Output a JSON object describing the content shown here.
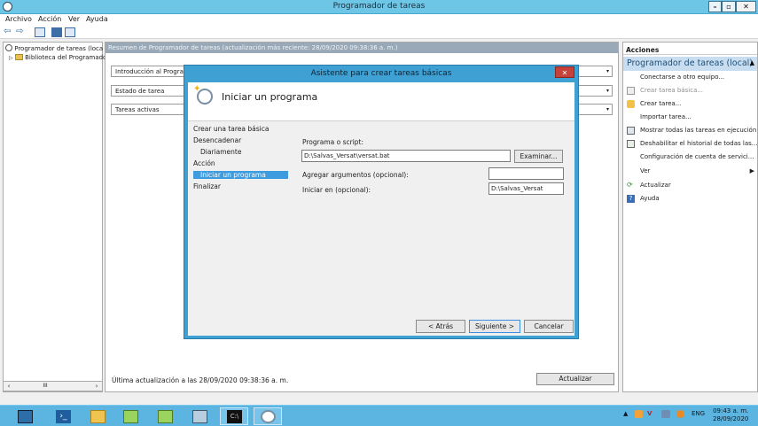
{
  "window": {
    "title": "Programador de tareas"
  },
  "menu": [
    "Archivo",
    "Acción",
    "Ver",
    "Ayuda"
  ],
  "tree": {
    "root": "Programador de tareas (local)",
    "child": "Biblioteca del Programador de tareas"
  },
  "center": {
    "summary_header": "Resumen de Programador de tareas (actualización más reciente: 28/09/2020 09:38:36 a. m.)",
    "sections": [
      "Introducción al Programador de tareas",
      "Estado de tarea",
      "Tareas activas"
    ],
    "last_update": "Última actualización a las 28/09/2020 09:38:36 a. m.",
    "refresh_button": "Actualizar"
  },
  "actions": {
    "header": "Acciones",
    "subheader": "Programador de tareas (local)",
    "items": [
      {
        "label": "Conectarse a otro equipo...",
        "icon": "none",
        "disabled": false,
        "submenu": false
      },
      {
        "label": "Crear tarea básica...",
        "icon": "wizard-icon",
        "disabled": true,
        "submenu": false
      },
      {
        "label": "Crear tarea...",
        "icon": "new-task-icon",
        "disabled": false,
        "submenu": false
      },
      {
        "label": "Importar tarea...",
        "icon": "none",
        "disabled": false,
        "submenu": false
      },
      {
        "label": "Mostrar todas las tareas en ejecución",
        "icon": "running-tasks-icon",
        "disabled": false,
        "submenu": false
      },
      {
        "label": "Deshabilitar el historial de todas las...",
        "icon": "history-icon",
        "disabled": false,
        "submenu": false
      },
      {
        "label": "Configuración de cuenta de servici...",
        "icon": "none",
        "disabled": false,
        "submenu": false
      },
      {
        "label": "Ver",
        "icon": "none",
        "disabled": false,
        "submenu": true
      },
      {
        "label": "Actualizar",
        "icon": "refresh-icon",
        "disabled": false,
        "submenu": false
      },
      {
        "label": "Ayuda",
        "icon": "help-icon",
        "disabled": false,
        "submenu": false
      }
    ]
  },
  "dialog": {
    "title": "Asistente para crear tareas básicas",
    "heading": "Iniciar un programa",
    "steps": [
      {
        "label": "Crear una tarea básica",
        "level": 0,
        "active": false
      },
      {
        "label": "Desencadenar",
        "level": 0,
        "active": false
      },
      {
        "label": "Diariamente",
        "level": 1,
        "active": false
      },
      {
        "label": "Acción",
        "level": 0,
        "active": false
      },
      {
        "label": "Iniciar un programa",
        "level": 1,
        "active": true
      },
      {
        "label": "Finalizar",
        "level": 0,
        "active": false
      }
    ],
    "program_label": "Programa o script:",
    "program_value": "D:\\Salvas_Versat\\versat.bat",
    "browse_button": "Examinar...",
    "args_label": "Agregar argumentos (opcional):",
    "args_value": "",
    "startin_label": "Iniciar en (opcional):",
    "startin_value": "D:\\Salvas_Versat",
    "back_button": "< Atrás",
    "next_button": "Siguiente >",
    "cancel_button": "Cancelar"
  },
  "taskbar": {
    "language": "ENG",
    "time": "09:43 a. m.",
    "date": "28/09/2020"
  },
  "colors": {
    "titlebar": "#6ec6e6",
    "dialog_frame": "#3fa0d4",
    "taskbar": "#5cb4e0",
    "accent": "#3d9be0"
  }
}
